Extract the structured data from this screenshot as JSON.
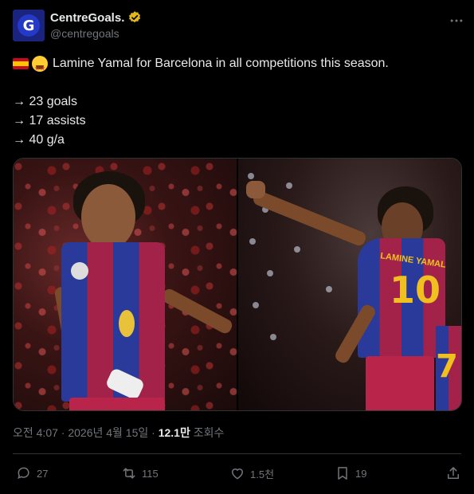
{
  "account": {
    "display_name": "CentreGoals.",
    "handle": "@centregoals",
    "avatar_letter": "G"
  },
  "tweet": {
    "headline": "Lamine Yamal for Barcelona in all competitions this season.",
    "stats": [
      "→ 23 goals",
      "→ 17 assists",
      "→ 40 g/a"
    ]
  },
  "media": {
    "photo2_name": "LAMINE YAMAL",
    "photo2_number": "10",
    "photo2_bg_number": "7"
  },
  "meta": {
    "timestamp": "오전 4:07 · 2026년 4월 15일 · ",
    "views_count": "12.1만",
    "views_label": " 조회수"
  },
  "actions": {
    "replies": "27",
    "reposts": "115",
    "likes": "1.5천",
    "bookmarks": "19"
  },
  "colors": {
    "background": "#000000",
    "text_primary": "#e7e9ea",
    "text_secondary": "#71767b",
    "verified_gold": "#e2b719",
    "divider": "#2f3336"
  }
}
